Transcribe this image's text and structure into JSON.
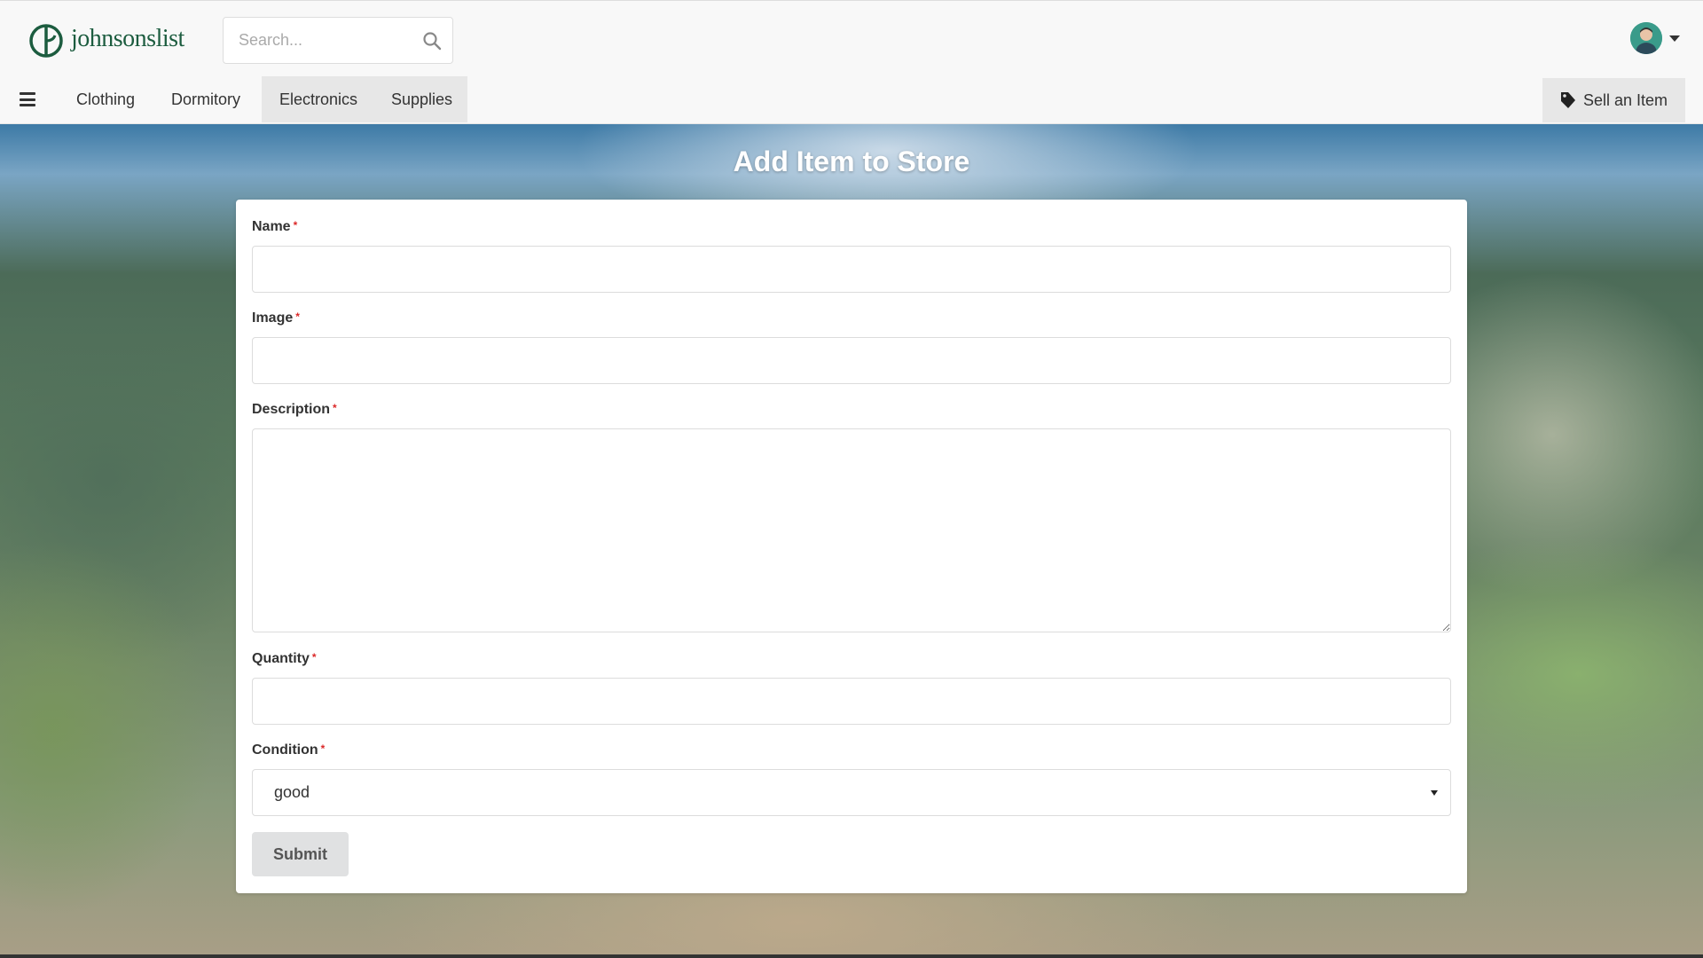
{
  "header": {
    "logo_text": "johnsonslist",
    "search": {
      "placeholder": "Search...",
      "value": ""
    },
    "brand_color": "#1c5c3f"
  },
  "nav": {
    "items": [
      {
        "label": "Clothing",
        "active": false
      },
      {
        "label": "Dormitory",
        "active": false
      },
      {
        "label": "Electronics",
        "active": true
      },
      {
        "label": "Supplies",
        "active": true
      }
    ],
    "sell_label": "Sell an Item"
  },
  "main": {
    "title": "Add Item to Store",
    "form": {
      "name_label": "Name",
      "name_value": "",
      "image_label": "Image",
      "image_value": "",
      "description_label": "Description",
      "description_value": "",
      "quantity_label": "Quantity",
      "quantity_value": "",
      "condition_label": "Condition",
      "condition_value": "good",
      "required_marker": "*",
      "submit_label": "Submit"
    }
  }
}
